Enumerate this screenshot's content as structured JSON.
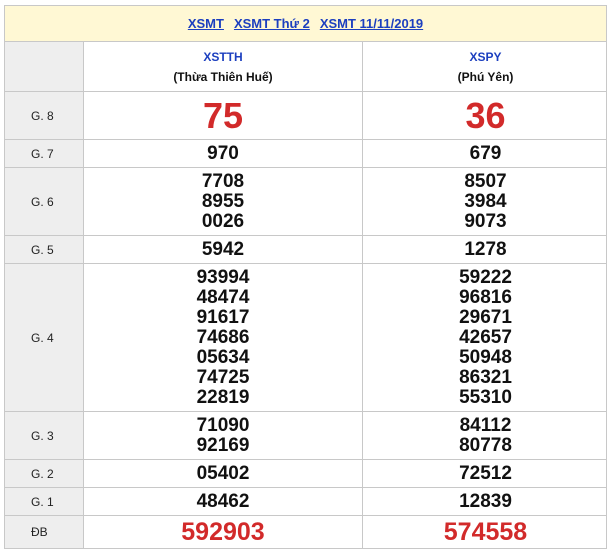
{
  "header_links": [
    "XSMT",
    "XSMT Thứ 2",
    "XSMT 11/11/2019"
  ],
  "provinces": [
    {
      "code": "XSTTH",
      "name": "(Thừa Thiên Huế)"
    },
    {
      "code": "XSPY",
      "name": "(Phú Yên)"
    }
  ],
  "prizes": [
    {
      "label": "G. 8",
      "left": [
        "75"
      ],
      "right": [
        "36"
      ]
    },
    {
      "label": "G. 7",
      "left": [
        "970"
      ],
      "right": [
        "679"
      ]
    },
    {
      "label": "G. 6",
      "left": [
        "7708",
        "8955",
        "0026"
      ],
      "right": [
        "8507",
        "3984",
        "9073"
      ]
    },
    {
      "label": "G. 5",
      "left": [
        "5942"
      ],
      "right": [
        "1278"
      ]
    },
    {
      "label": "G. 4",
      "left": [
        "93994",
        "48474",
        "91617",
        "74686",
        "05634",
        "74725",
        "22819"
      ],
      "right": [
        "59222",
        "96816",
        "29671",
        "42657",
        "50948",
        "86321",
        "55310"
      ]
    },
    {
      "label": "G. 3",
      "left": [
        "71090",
        "92169"
      ],
      "right": [
        "84112",
        "80778"
      ]
    },
    {
      "label": "G. 2",
      "left": [
        "05402"
      ],
      "right": [
        "72512"
      ]
    },
    {
      "label": "G. 1",
      "left": [
        "48462"
      ],
      "right": [
        "12839"
      ]
    },
    {
      "label": "ĐB",
      "left": [
        "592903"
      ],
      "right": [
        "574558"
      ]
    }
  ]
}
